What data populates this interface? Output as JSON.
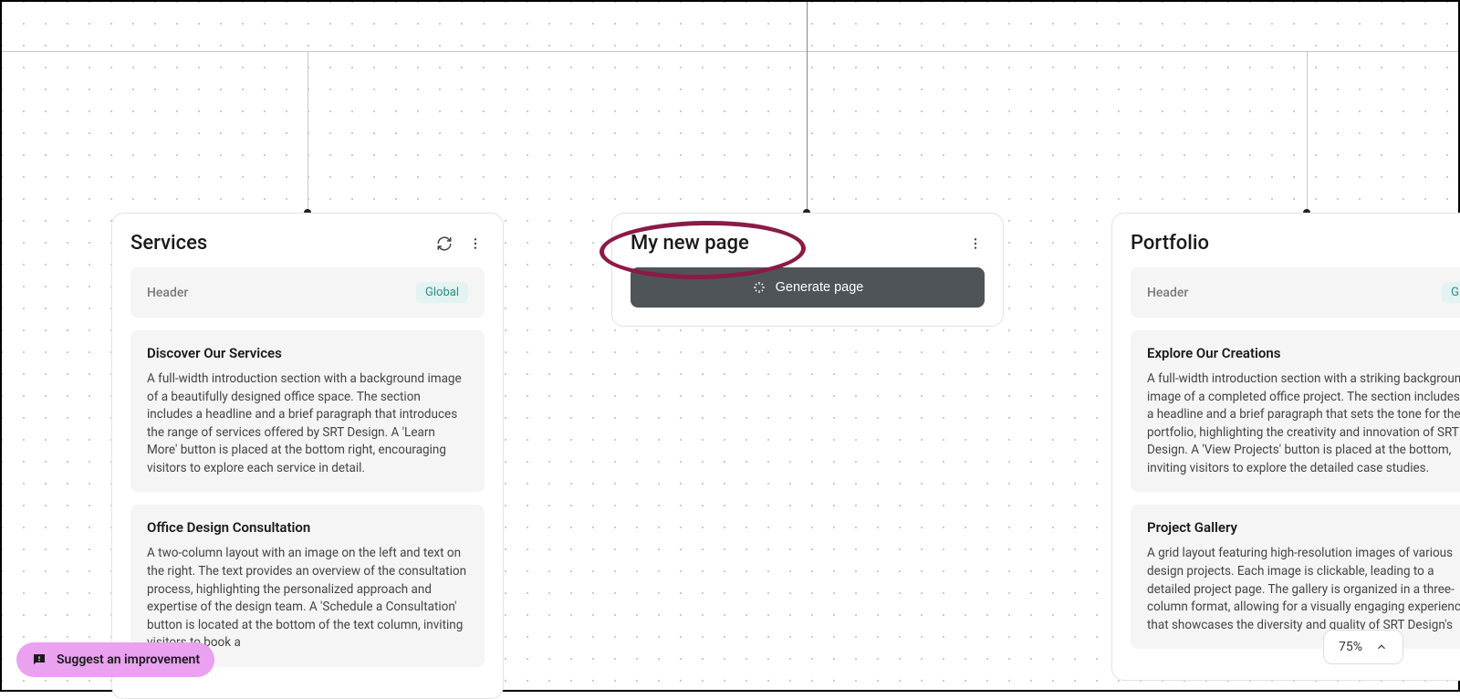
{
  "cards": {
    "services": {
      "title": "Services",
      "header": {
        "label": "Header",
        "tag": "Global"
      },
      "sections": [
        {
          "title": "Discover Our Services",
          "body": "A full-width introduction section with a background image of a beautifully designed office space. The section includes a headline and a brief paragraph that introduces the range of services offered by SRT Design. A 'Learn More' button is placed at the bottom right, encouraging visitors to explore each service in detail."
        },
        {
          "title": "Office Design Consultation",
          "body": "A two-column layout with an image on the left and text on the right. The text provides an overview of the consultation process, highlighting the personalized approach and expertise of the design team. A 'Schedule a Consultation' button is located at the bottom of the text column, inviting visitors to book a"
        }
      ]
    },
    "newpage": {
      "title": "My new page",
      "generate_label": "Generate page"
    },
    "portfolio": {
      "title": "Portfolio",
      "header": {
        "label": "Header",
        "tag": "G"
      },
      "sections": [
        {
          "title": "Explore Our Creations",
          "body": "A full-width introduction section with a striking background image of a completed office project. The section includes a headline and a brief paragraph that sets the tone for the portfolio, highlighting the creativity and innovation of SRT Design. A 'View Projects' button is placed at the bottom, inviting visitors to explore the detailed case studies."
        },
        {
          "title": "Project Gallery",
          "body": "A grid layout featuring high-resolution images of various design projects. Each image is clickable, leading to a detailed project page. The gallery is organized in a three-column format, allowing for a visually engaging experience that showcases the diversity and quality of SRT Design's"
        }
      ]
    }
  },
  "suggest_label": "Suggest an improvement",
  "zoom_label": "75%"
}
